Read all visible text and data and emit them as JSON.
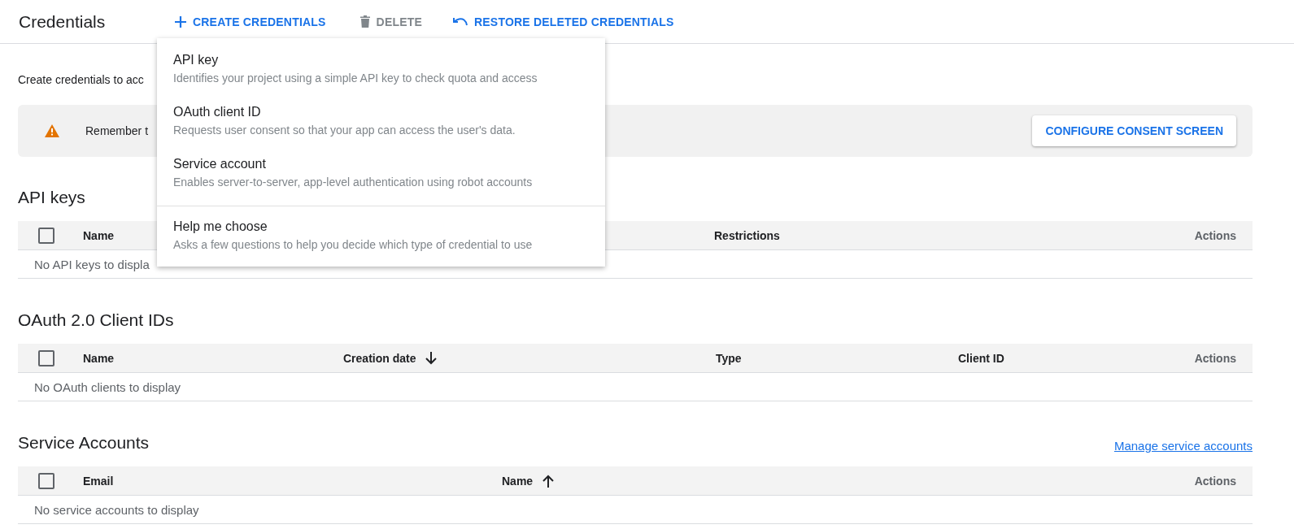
{
  "header": {
    "title": "Credentials",
    "actions": [
      {
        "kind": "create",
        "label": "CREATE CREDENTIALS",
        "disabled": false
      },
      {
        "kind": "delete",
        "label": "DELETE",
        "disabled": true
      },
      {
        "kind": "restore",
        "label": "RESTORE DELETED CREDENTIALS",
        "disabled": false
      }
    ]
  },
  "intro": "Create credentials to acc",
  "banner": {
    "text": "Remember t",
    "button": "CONFIGURE CONSENT SCREEN"
  },
  "sections": [
    {
      "title": "API keys",
      "checked": false,
      "columns": [
        {
          "label": "Name"
        },
        {
          "label": "Restrictions"
        },
        {
          "label": "Actions"
        }
      ],
      "empty": "No API keys to displa"
    },
    {
      "title": "OAuth 2.0 Client IDs",
      "checked": false,
      "columns": [
        {
          "label": "Name"
        },
        {
          "label": "Creation date",
          "sorted": true,
          "descending": true
        },
        {
          "label": "Type"
        },
        {
          "label": "Client ID"
        },
        {
          "label": "Actions"
        }
      ],
      "empty": "No OAuth clients to display"
    },
    {
      "title": "Service Accounts",
      "checked": false,
      "link": "Manage service accounts",
      "columns": [
        {
          "label": "Email"
        },
        {
          "label": "Name",
          "sorted": true,
          "descending": false
        },
        {
          "label": "Actions"
        }
      ],
      "empty": "No service accounts to display"
    }
  ],
  "menu": {
    "groups": [
      [
        {
          "title": "API key",
          "description": "Identifies your project using a simple API key to check quota and access"
        },
        {
          "title": "OAuth client ID",
          "description": "Requests user consent so that your app can access the user's data."
        },
        {
          "title": "Service account",
          "description": "Enables server-to-server, app-level authentication using robot accounts"
        }
      ],
      [
        {
          "title": "Help me choose",
          "description": "Asks a few questions to help you decide which type of credential to use"
        }
      ]
    ]
  }
}
